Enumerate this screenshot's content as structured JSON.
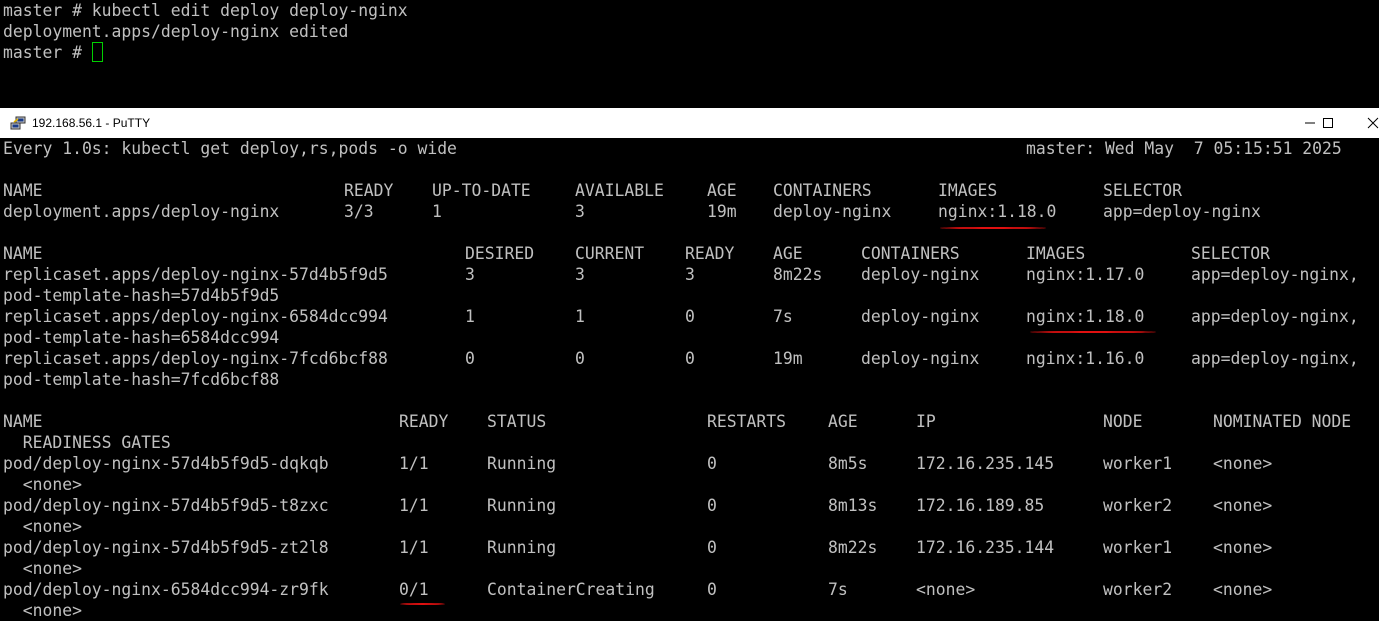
{
  "top_terminal": {
    "lines": [
      "master # kubectl edit deploy deploy-nginx",
      "deployment.apps/deploy-nginx edited",
      "master # "
    ]
  },
  "window": {
    "title": "192.168.56.1 - PuTTY",
    "icon": "putty-icon",
    "controls": {
      "minimize": "minimize-icon",
      "maximize": "maximize-icon",
      "close": "close-icon"
    }
  },
  "watch": {
    "left": "Every 1.0s: kubectl get deploy,rs,pods -o wide",
    "right": "master: Wed May  7 05:15:51 2025"
  },
  "deploy": {
    "headers": [
      "NAME",
      "READY",
      "UP-TO-DATE",
      "AVAILABLE",
      "AGE",
      "CONTAINERS",
      "IMAGES",
      "SELECTOR"
    ],
    "rows": [
      [
        "deployment.apps/deploy-nginx",
        "3/3",
        "1",
        "3",
        "19m",
        "deploy-nginx",
        "nginx:1.18.0",
        "app=deploy-nginx"
      ]
    ]
  },
  "rs": {
    "headers": [
      "NAME",
      "DESIRED",
      "CURRENT",
      "READY",
      "AGE",
      "CONTAINERS",
      "IMAGES",
      "SELECTOR"
    ],
    "rows": [
      {
        "cells": [
          "replicaset.apps/deploy-nginx-57d4b5f9d5",
          "3",
          "3",
          "3",
          "8m22s",
          "deploy-nginx",
          "nginx:1.17.0",
          "app=deploy-nginx,"
        ],
        "cont": "pod-template-hash=57d4b5f9d5"
      },
      {
        "cells": [
          "replicaset.apps/deploy-nginx-6584dcc994",
          "1",
          "1",
          "0",
          "7s",
          "deploy-nginx",
          "nginx:1.18.0",
          "app=deploy-nginx,"
        ],
        "cont": "pod-template-hash=6584dcc994"
      },
      {
        "cells": [
          "replicaset.apps/deploy-nginx-7fcd6bcf88",
          "0",
          "0",
          "0",
          "19m",
          "deploy-nginx",
          "nginx:1.16.0",
          "app=deploy-nginx,"
        ],
        "cont": "pod-template-hash=7fcd6bcf88"
      }
    ]
  },
  "pods": {
    "headers": [
      "NAME",
      "READY",
      "STATUS",
      "RESTARTS",
      "AGE",
      "IP",
      "NODE",
      "NOMINATED NODE"
    ],
    "header_cont": "  READINESS GATES",
    "rows": [
      {
        "cells": [
          "pod/deploy-nginx-57d4b5f9d5-dqkqb",
          "1/1",
          "Running",
          "0",
          "8m5s",
          "172.16.235.145",
          "worker1",
          "<none>"
        ],
        "cont": "  <none>"
      },
      {
        "cells": [
          "pod/deploy-nginx-57d4b5f9d5-t8zxc",
          "1/1",
          "Running",
          "0",
          "8m13s",
          "172.16.189.85",
          "worker2",
          "<none>"
        ],
        "cont": "  <none>"
      },
      {
        "cells": [
          "pod/deploy-nginx-57d4b5f9d5-zt2l8",
          "1/1",
          "Running",
          "0",
          "8m22s",
          "172.16.235.144",
          "worker1",
          "<none>"
        ],
        "cont": "  <none>"
      },
      {
        "cells": [
          "pod/deploy-nginx-6584dcc994-zr9fk",
          "0/1",
          "ContainerCreating",
          "0",
          "7s",
          "<none>",
          "worker2",
          "<none>"
        ],
        "cont": "  <none>"
      }
    ]
  },
  "colors": {
    "terminal_bg": "#000000",
    "terminal_fg": "#c0c0c0",
    "cursor": "#00d000",
    "annotation": "#e01010"
  }
}
